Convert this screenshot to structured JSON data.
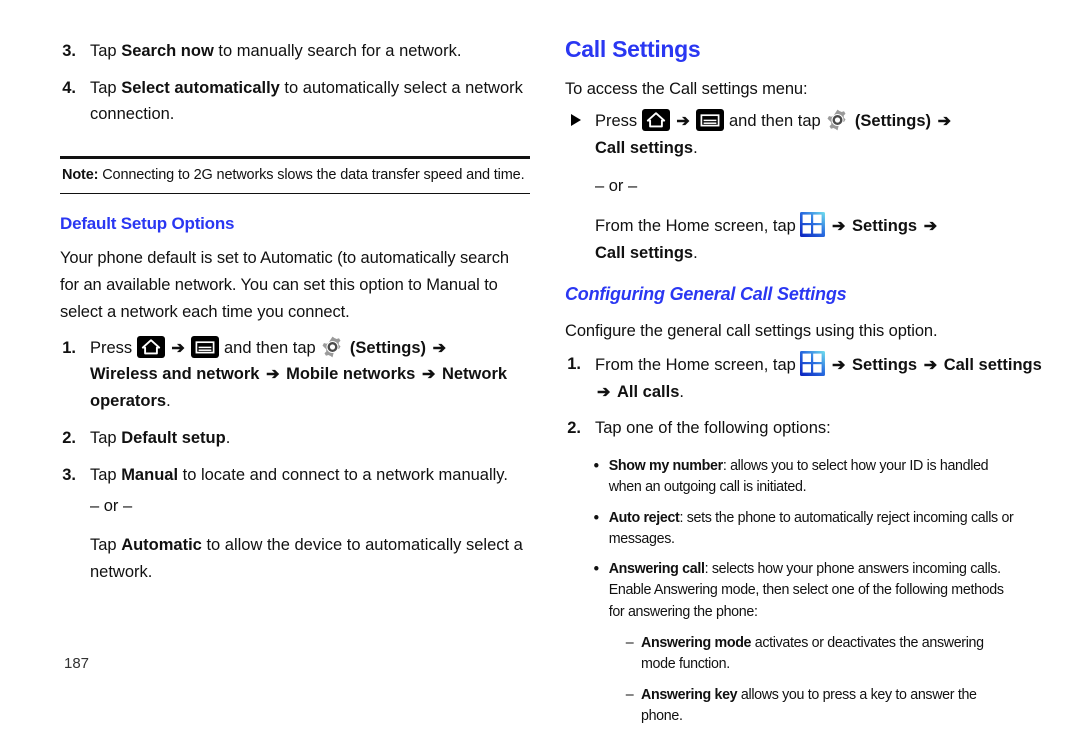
{
  "page_number": "187",
  "colors": {
    "heading_blue": "#2a37f2",
    "text_black": "#111111",
    "icon_black": "#000000",
    "grid_icon_blue": "#1a3fd0",
    "grid_icon_cyan": "#5fd8e8",
    "gear_gray": "#9a9a9a"
  },
  "icons": {
    "home": "home-icon",
    "menu": "menu-icon",
    "gear": "gear-settings-icon",
    "grid": "apps-grid-icon",
    "arrow": "➔",
    "triangle_bullet": "triangle-bullet-icon"
  },
  "left_column": {
    "steps_top": [
      {
        "num": "3.",
        "parts": [
          {
            "text": "Tap ",
            "bold": false
          },
          {
            "text": "Search now",
            "bold": true
          },
          {
            "text": " to manually search for a network.",
            "bold": false
          }
        ]
      },
      {
        "num": "4.",
        "parts": [
          {
            "text": "Tap ",
            "bold": false
          },
          {
            "text": "Select automatically",
            "bold": true
          },
          {
            "text": " to automatically select a network connection.",
            "bold": false
          }
        ]
      }
    ],
    "note": {
      "label": "Note:",
      "text": "Connecting to 2G networks slows the data transfer speed and time."
    },
    "section_heading": "Default Setup Options",
    "intro_paragraph": "Your phone default is set to Automatic (to automatically search for an available network. You can set this option to Manual to select a network each time you connect.",
    "step1": {
      "num": "1.",
      "press_label": "Press",
      "and_then_tap": "and then tap",
      "settings_paren": "(Settings)",
      "path": [
        "Wireless and network",
        "Mobile networks",
        "Network operators"
      ],
      "trailing_period": "."
    },
    "step2": {
      "num": "2.",
      "parts": [
        {
          "text": "Tap ",
          "bold": false
        },
        {
          "text": "Default setup",
          "bold": true
        },
        {
          "text": ".",
          "bold": false
        }
      ]
    },
    "step3": {
      "num": "3.",
      "parts": [
        {
          "text": "Tap ",
          "bold": false
        },
        {
          "text": "Manual",
          "bold": true
        },
        {
          "text": " to locate and connect to a network manually.",
          "bold": false
        }
      ],
      "or_divider": "– or –",
      "alt_parts": [
        {
          "text": "Tap ",
          "bold": false
        },
        {
          "text": "Automatic",
          "bold": true
        },
        {
          "text": " to allow the device to automatically select a network.",
          "bold": false
        }
      ]
    }
  },
  "right_column": {
    "title": "Call Settings",
    "intro": "To access the Call settings menu:",
    "access_step": {
      "press_label": "Press",
      "and_then_tap": "and then tap",
      "settings_paren": "(Settings)",
      "target": "Call settings",
      "trailing_period": "."
    },
    "or_divider": "– or –",
    "home_screen_step": {
      "lead": "From the Home screen, tap",
      "settings_label": "Settings",
      "target": "Call settings",
      "trailing_period": "."
    },
    "subsection_heading": "Configuring General Call Settings",
    "subsection_intro": "Configure the general call settings using this option.",
    "step1": {
      "num": "1.",
      "lead": "From the Home screen, tap",
      "path": [
        "Settings",
        "Call settings",
        "All calls"
      ],
      "trailing_period": "."
    },
    "step2": {
      "num": "2.",
      "text": "Tap one of the following options:"
    },
    "options": [
      {
        "term": "Show my number",
        "desc": ": allows you to select how your ID is handled when an outgoing call is initiated."
      },
      {
        "term": "Auto reject",
        "desc": ": sets the phone to automatically reject incoming calls or messages."
      },
      {
        "term": "Answering call",
        "desc": ": selects how your phone answers incoming calls. Enable Answering mode, then select one of the following methods for answering the phone:",
        "sub_items": [
          {
            "term": "Answering mode",
            "desc": " activates or deactivates the answering mode function."
          },
          {
            "term": "Answering key",
            "desc": " allows you to press a key to answer the phone."
          }
        ]
      }
    ]
  }
}
